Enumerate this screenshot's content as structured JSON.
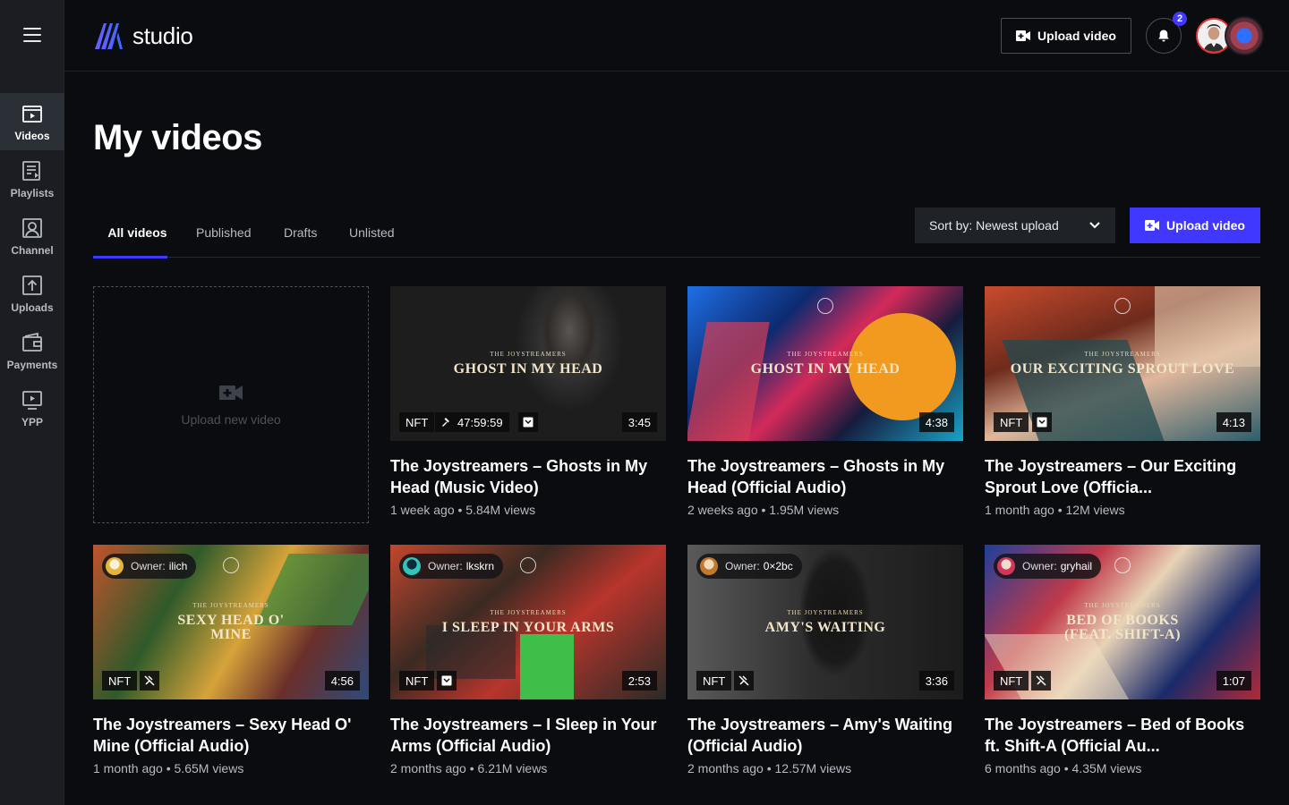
{
  "app": {
    "logo_text": "studio"
  },
  "sidebar": {
    "items": [
      {
        "label": "Videos",
        "icon": "videos-icon",
        "active": true
      },
      {
        "label": "Playlists",
        "icon": "playlists-icon"
      },
      {
        "label": "Channel",
        "icon": "channel-icon"
      },
      {
        "label": "Uploads",
        "icon": "uploads-icon"
      },
      {
        "label": "Payments",
        "icon": "payments-icon"
      },
      {
        "label": "YPP",
        "icon": "ypp-icon"
      }
    ]
  },
  "header": {
    "upload_label": "Upload video",
    "notification_count": "2"
  },
  "main": {
    "title": "My videos",
    "tabs": [
      "All videos",
      "Published",
      "Drafts",
      "Unlisted"
    ],
    "sort_label": "Sort by: Newest upload",
    "upload_label": "Upload video",
    "upload_new_label": "Upload new video"
  },
  "videos": [
    {
      "series": "THE JOYSTREAMERS",
      "song": "GHOST IN MY HEAD",
      "nft": "NFT",
      "timer": "47:59:59",
      "duration": "3:45",
      "title": "The Joystreamers – Ghosts in My Head (Music Video)",
      "meta": "1 week ago • 5.84M views"
    },
    {
      "series": "THE JOYSTREAMERS",
      "song": "GHOST IN MY HEAD",
      "duration": "4:38",
      "title": "The Joystreamers – Ghosts in My Head (Official Audio)",
      "meta": "2 weeks ago • 1.95M views"
    },
    {
      "series": "THE JOYSTREAMERS",
      "song": "OUR EXCITING SPROUT LOVE",
      "nft": "NFT",
      "duration": "4:13",
      "title": "The Joystreamers – Our Exciting Sprout Love (Officia...",
      "meta": "1 month ago • 12M views"
    },
    {
      "owner_label": "Owner:",
      "owner": "ilich",
      "series": "THE JOYSTREAMERS",
      "song": "SEXY HEAD O' MINE",
      "nft": "NFT",
      "duration": "4:56",
      "title": "The Joystreamers – Sexy Head O' Mine (Official Audio)",
      "meta": "1 month ago • 5.65M views"
    },
    {
      "owner_label": "Owner:",
      "owner": "lkskrn",
      "series": "THE JOYSTREAMERS",
      "song": "I SLEEP IN YOUR ARMS",
      "nft": "NFT",
      "duration": "2:53",
      "title": "The Joystreamers – I Sleep in Your Arms (Official Audio)",
      "meta": "2 months ago • 6.21M views"
    },
    {
      "owner_label": "Owner:",
      "owner": "0×2bc",
      "series": "THE JOYSTREAMERS",
      "song": "AMY'S WAITING",
      "nft": "NFT",
      "duration": "3:36",
      "title": "The Joystreamers – Amy's Waiting (Official Audio)",
      "meta": "2 months ago • 12.57M views"
    },
    {
      "owner_label": "Owner:",
      "owner": "gryhail",
      "series": "THE JOYSTREAMERS",
      "song": "BED OF BOOKS (FEAT. SHIFT-A)",
      "nft": "NFT",
      "duration": "1:07",
      "title": "The Joystreamers – Bed of Books ft. Shift-A (Official Au...",
      "meta": "6 months ago • 4.35M views"
    }
  ],
  "colors": {
    "accent": "#4038ff",
    "background": "#0b0c0f",
    "sidebar": "#1b1d22"
  }
}
